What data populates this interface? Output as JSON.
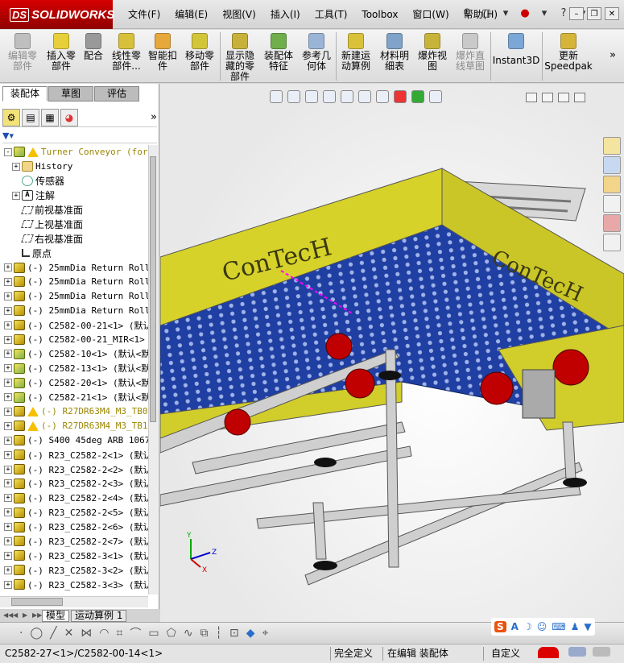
{
  "app": {
    "brand": "SOLIDWORKS",
    "brand_prefix": "DS"
  },
  "menu": [
    "文件(F)",
    "编辑(E)",
    "视图(V)",
    "插入(I)",
    "工具(T)",
    "Toolbox",
    "窗口(W)",
    "帮助(H)"
  ],
  "title_tools": {
    "pin": "pin-icon",
    "new": "new-doc-icon",
    "options": "options-icon",
    "help": "?"
  },
  "ribbon": [
    {
      "label": "编辑零部件",
      "icon": "edit-component-icon",
      "enabled": false
    },
    {
      "label": "插入零部件",
      "icon": "insert-components-icon",
      "enabled": true
    },
    {
      "label": "配合",
      "icon": "mate-icon",
      "enabled": true
    },
    {
      "label": "线性零部件...",
      "icon": "linear-pattern-icon",
      "enabled": true
    },
    {
      "label": "智能扣件",
      "icon": "smart-fasteners-icon",
      "enabled": true
    },
    {
      "label": "移动零部件",
      "icon": "move-component-icon",
      "enabled": true
    },
    {
      "label": "显示隐藏的零部件",
      "icon": "show-hidden-icon",
      "enabled": true
    },
    {
      "label": "装配体特征",
      "icon": "assembly-features-icon",
      "enabled": true
    },
    {
      "label": "参考几何体",
      "icon": "reference-geometry-icon",
      "enabled": true
    },
    {
      "label": "新建运动算例",
      "icon": "new-motion-study-icon",
      "enabled": true
    },
    {
      "label": "材料明细表",
      "icon": "bom-icon",
      "enabled": true
    },
    {
      "label": "爆炸视图",
      "icon": "exploded-view-icon",
      "enabled": true
    },
    {
      "label": "爆炸直线草图",
      "icon": "explode-line-sketch-icon",
      "enabled": false
    },
    {
      "label": "Instant3D",
      "icon": "instant3d-icon",
      "enabled": true
    },
    {
      "label": "更新Speedpak",
      "icon": "speedpak-icon",
      "enabled": true
    }
  ],
  "panel_tabs": [
    "装配体",
    "草图",
    "评估"
  ],
  "tree": [
    {
      "icon": "asm",
      "text": "Turner Conveyor (for Der",
      "expander": "-",
      "warn": true
    },
    {
      "icon": "folder",
      "text": "History",
      "expander": "+",
      "indent": 1
    },
    {
      "icon": "sensor",
      "text": "传感器",
      "expander": "",
      "indent": 1
    },
    {
      "icon": "a",
      "text": "注解",
      "expander": "+",
      "indent": 1
    },
    {
      "icon": "plane",
      "text": "前视基准面",
      "expander": "",
      "indent": 1
    },
    {
      "icon": "plane",
      "text": "上视基准面",
      "expander": "",
      "indent": 1
    },
    {
      "icon": "plane",
      "text": "右视基准面",
      "expander": "",
      "indent": 1
    },
    {
      "icon": "origin",
      "text": "原点",
      "expander": "",
      "indent": 1
    },
    {
      "icon": "part",
      "text": "(-) 25mmDia Return Roll",
      "expander": "+"
    },
    {
      "icon": "part",
      "text": "(-) 25mmDia Return Roll",
      "expander": "+"
    },
    {
      "icon": "part",
      "text": "(-) 25mmDia Return Roll",
      "expander": "+"
    },
    {
      "icon": "part",
      "text": "(-) 25mmDia Return Roll",
      "expander": "+"
    },
    {
      "icon": "part",
      "text": "(-) C2582-00-21<1> (默认",
      "expander": "+"
    },
    {
      "icon": "part",
      "text": "(-) C2582-00-21_MIR<1>",
      "expander": "+"
    },
    {
      "icon": "asm",
      "text": "(-) C2582-10<1> (默认<默",
      "expander": "+"
    },
    {
      "icon": "asm",
      "text": "(-) C2582-13<1> (默认<默",
      "expander": "+"
    },
    {
      "icon": "asm",
      "text": "(-) C2582-20<1> (默认<默",
      "expander": "+"
    },
    {
      "icon": "asm",
      "text": "(-) C2582-21<1> (默认<默",
      "expander": "+"
    },
    {
      "icon": "part",
      "text": "(-) R27DR63M4_M3_TB0",
      "expander": "+",
      "warn": true
    },
    {
      "icon": "part",
      "text": "(-) R27DR63M4_M3_TB1(",
      "expander": "+",
      "warn": true
    },
    {
      "icon": "part",
      "text": "(-) S400 45deg ARB 1067",
      "expander": "+"
    },
    {
      "icon": "part",
      "text": "(-) R23_C2582-2<1> (默认",
      "expander": "+"
    },
    {
      "icon": "part",
      "text": "(-) R23_C2582-2<2> (默认",
      "expander": "+"
    },
    {
      "icon": "part",
      "text": "(-) R23_C2582-2<3> (默认",
      "expander": "+"
    },
    {
      "icon": "part",
      "text": "(-) R23_C2582-2<4> (默认",
      "expander": "+"
    },
    {
      "icon": "part",
      "text": "(-) R23_C2582-2<5> (默认",
      "expander": "+"
    },
    {
      "icon": "part",
      "text": "(-) R23_C2582-2<6> (默认",
      "expander": "+"
    },
    {
      "icon": "part",
      "text": "(-) R23_C2582-2<7> (默认",
      "expander": "+"
    },
    {
      "icon": "part",
      "text": "(-) R23_C2582-3<1> (默认",
      "expander": "+"
    },
    {
      "icon": "part",
      "text": "(-) R23_C2582-3<2> (默认",
      "expander": "+"
    },
    {
      "icon": "part",
      "text": "(-) R23_C2582-3<3> (默认",
      "expander": "+"
    }
  ],
  "bottom_tabs": [
    "模型",
    "运动算例 1"
  ],
  "viewport": {
    "brand_text": "ConTecH",
    "triad": {
      "x": "X",
      "y": "Y",
      "z": "Z"
    }
  },
  "status": {
    "path": "C2582-27<1>/C2582-00-14<1>",
    "state": "完全定义",
    "mode": "在编辑 装配体",
    "custom": "自定义"
  },
  "colors": {
    "frame": "#c9c9c9",
    "hood": "#d6d22a",
    "belt": "#1f3fa3",
    "motor": "#c00000"
  }
}
